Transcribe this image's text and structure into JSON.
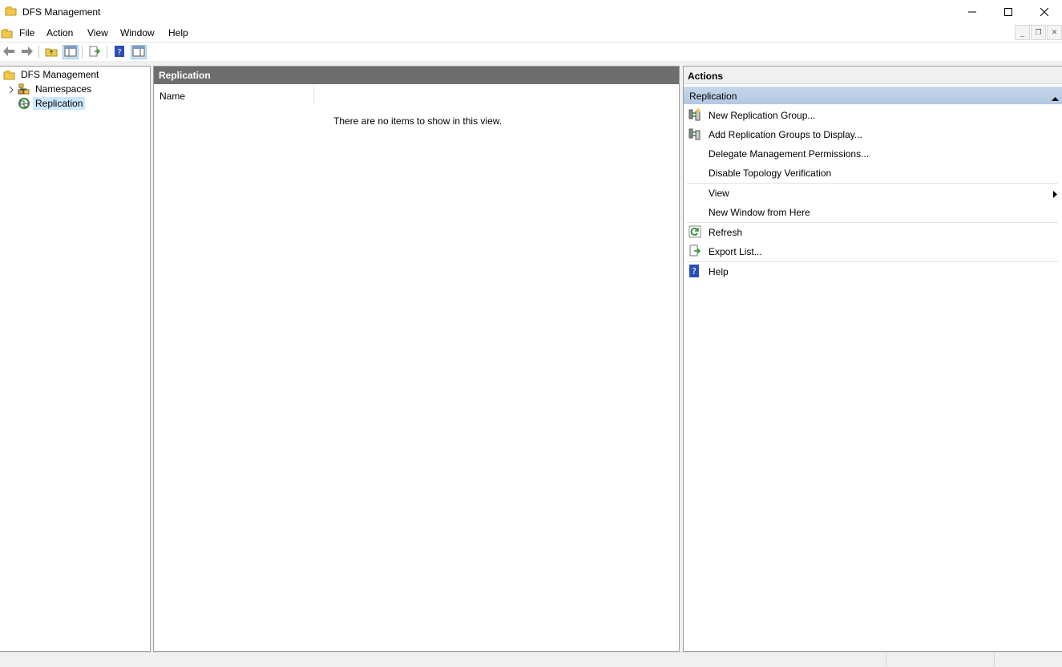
{
  "window": {
    "title": "DFS Management",
    "icon": "dfs-folder-icon",
    "controls": [
      "minimize-icon",
      "maximize-icon",
      "close-icon"
    ]
  },
  "menu": {
    "items": [
      "File",
      "Action",
      "View",
      "Window",
      "Help"
    ]
  },
  "toolbar": {
    "buttons": [
      "back-icon",
      "forward-icon",
      "up-folder-icon",
      "show-hide-console-tree-icon",
      "export-list-icon",
      "help-icon",
      "show-hide-action-pane-icon"
    ]
  },
  "tree": {
    "root": "DFS Management",
    "children": [
      {
        "label": "Namespaces",
        "icon": "namespaces-icon"
      },
      {
        "label": "Replication",
        "icon": "replication-icon",
        "selected": true
      }
    ]
  },
  "main": {
    "header": "Replication",
    "column": "Name",
    "empty_message": "There are no items to show in this view."
  },
  "actions": {
    "header": "Actions",
    "section": "Replication",
    "items": [
      {
        "label": "New Replication Group...",
        "icon": "new-replication-group-icon"
      },
      {
        "label": "Add Replication Groups to Display...",
        "icon": "add-replication-groups-icon"
      },
      {
        "label": "Delegate Management Permissions...",
        "icon": ""
      },
      {
        "label": "Disable Topology Verification",
        "icon": ""
      },
      {
        "label": "View",
        "icon": "",
        "submenu": true
      },
      {
        "label": "New Window from Here",
        "icon": ""
      },
      {
        "label": "Refresh",
        "icon": "refresh-icon"
      },
      {
        "label": "Export List...",
        "icon": "export-list-icon"
      },
      {
        "label": "Help",
        "icon": "help-icon"
      }
    ]
  },
  "colors": {
    "pane_header": "#6e6e6e",
    "section_header": "#bccfe6",
    "selection": "#cce8ff"
  }
}
